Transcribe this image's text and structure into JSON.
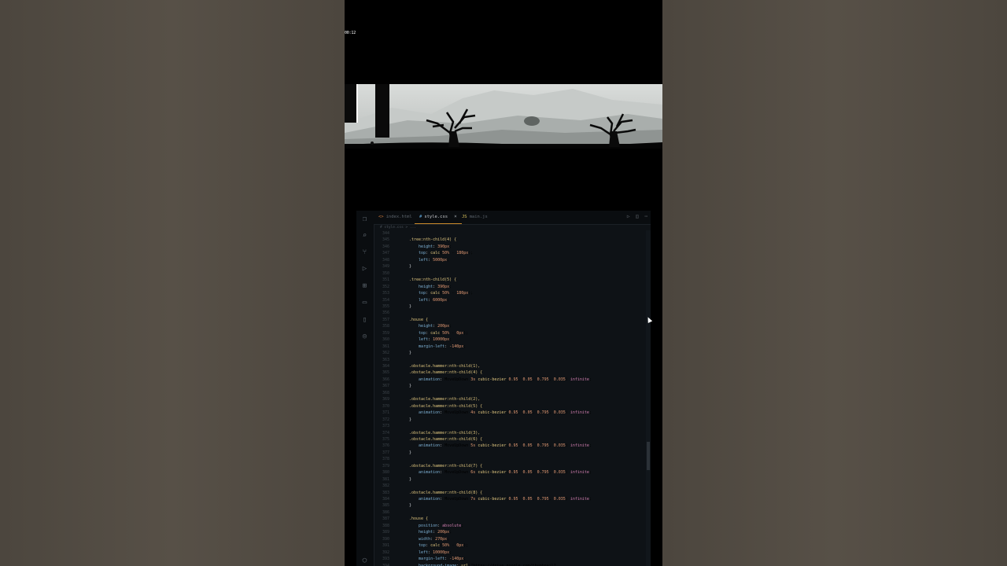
{
  "game": {
    "timer": "00:12"
  },
  "editor": {
    "tabs": [
      {
        "label": "index.html",
        "glyph": "<>"
      },
      {
        "label": "style.css",
        "glyph": "#"
      },
      {
        "label": "main.js",
        "glyph": "JS"
      }
    ],
    "tab_close": "×",
    "actions": [
      "▷",
      "◫",
      "⋯"
    ],
    "breadcrumb": "# style.css > ...",
    "activity_icons": [
      "files-icon",
      "search-icon",
      "source-control-icon",
      "run-debug-icon",
      "extensions-icon",
      "folder-icon",
      "mobile-icon",
      "remote-icon",
      "account-icon"
    ],
    "lines": [
      {
        "n": "344",
        "t": ""
      },
      {
        "n": "345",
        "t": ".tree:nth-child(4) {"
      },
      {
        "n": "346",
        "t": "    height: 390px;"
      },
      {
        "n": "347",
        "t": "    top: calc(50% - 180px);"
      },
      {
        "n": "348",
        "t": "    left: 5000px;"
      },
      {
        "n": "349",
        "t": "}"
      },
      {
        "n": "350",
        "t": ""
      },
      {
        "n": "351",
        "t": ".tree:nth-child(5) {"
      },
      {
        "n": "352",
        "t": "    height: 390px;"
      },
      {
        "n": "353",
        "t": "    top: calc(50% - 180px);"
      },
      {
        "n": "354",
        "t": "    left: 6000px;"
      },
      {
        "n": "355",
        "t": "}"
      },
      {
        "n": "356",
        "t": ""
      },
      {
        "n": "357",
        "t": ".house {"
      },
      {
        "n": "358",
        "t": "    height: 200px;"
      },
      {
        "n": "359",
        "t": "    top: calc(50% - 0px);"
      },
      {
        "n": "360",
        "t": "    left: 10000px;"
      },
      {
        "n": "361",
        "t": "    margin-left: -140px;"
      },
      {
        "n": "362",
        "t": "}"
      },
      {
        "n": "363",
        "t": ""
      },
      {
        "n": "364",
        "t": ".obstacle.hammer:nth-child(1),"
      },
      {
        "n": "365",
        "t": ".obstacle.hammer:nth-child(4) {"
      },
      {
        "n": "366",
        "t": "    animation: MoveUpDown 3s cubic-bezier(0.95, 0.05, 0.795, 0.035) infinite;"
      },
      {
        "n": "367",
        "t": "}"
      },
      {
        "n": "368",
        "t": ""
      },
      {
        "n": "369",
        "t": ".obstacle.hammer:nth-child(2),"
      },
      {
        "n": "370",
        "t": ".obstacle.hammer:nth-child(5) {"
      },
      {
        "n": "371",
        "t": "    animation: MoveUpDown 4s cubic-bezier(0.95, 0.05, 0.795, 0.035) infinite;"
      },
      {
        "n": "372",
        "t": "}"
      },
      {
        "n": "373",
        "t": ""
      },
      {
        "n": "374",
        "t": ".obstacle.hammer:nth-child(3),"
      },
      {
        "n": "375",
        "t": ".obstacle.hammer:nth-child(6) {"
      },
      {
        "n": "376",
        "t": "    animation: MoveUpDown 5s cubic-bezier(0.95, 0.05, 0.795, 0.035) infinite;"
      },
      {
        "n": "377",
        "t": "}"
      },
      {
        "n": "378",
        "t": ""
      },
      {
        "n": "379",
        "t": ".obstacle.hammer:nth-child(7) {"
      },
      {
        "n": "380",
        "t": "    animation: MoveUpDown 6s cubic-bezier(0.95, 0.05, 0.795, 0.035) infinite;"
      },
      {
        "n": "381",
        "t": "}"
      },
      {
        "n": "382",
        "t": ""
      },
      {
        "n": "383",
        "t": ".obstacle.hammer:nth-child(8) {"
      },
      {
        "n": "384",
        "t": "    animation: MoveUpDown 7s cubic-bezier(0.95, 0.05, 0.795, 0.035) infinite;"
      },
      {
        "n": "385",
        "t": "}"
      },
      {
        "n": "386",
        "t": ""
      },
      {
        "n": "387",
        "t": ".house {"
      },
      {
        "n": "388",
        "t": "    position: absolute;"
      },
      {
        "n": "389",
        "t": "    height: 200px;"
      },
      {
        "n": "390",
        "t": "    width: 270px;"
      },
      {
        "n": "391",
        "t": "    top: calc(50% - 0px);"
      },
      {
        "n": "392",
        "t": "    left: 10000px;"
      },
      {
        "n": "393",
        "t": "    margin-left: -140px;"
      },
      {
        "n": "394",
        "t": "    background-image: url(\"https://drive.google.com/thumbnail?"
      }
    ]
  }
}
